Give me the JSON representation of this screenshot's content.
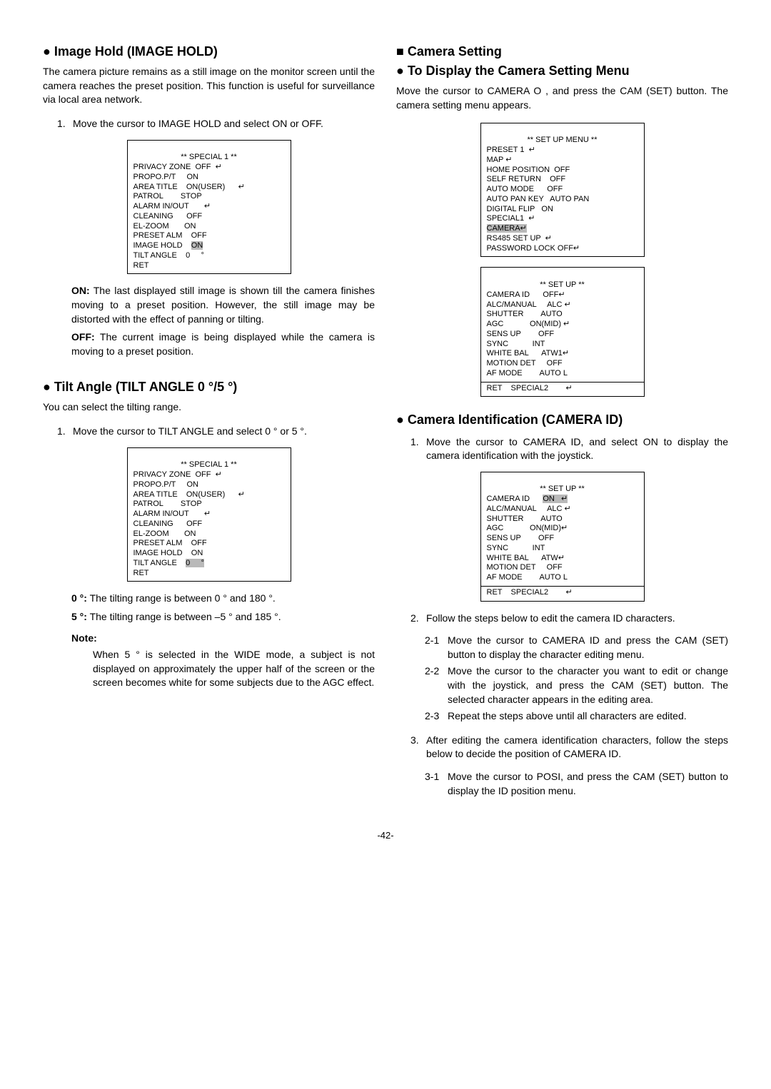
{
  "left": {
    "imageHold": {
      "heading": "Image Hold (IMAGE HOLD)",
      "intro": "The camera picture remains as a still image on the monitor screen until the camera reaches the preset position. This function is useful for surveillance via local area network.",
      "step1_num": "1.",
      "step1_txt": "Move the cursor to IMAGE HOLD and select ON or OFF.",
      "menu": {
        "title": "** SPECIAL 1 **",
        "l1": "PRIVACY ZONE  OFF  ↵",
        "l2": "PROPO.P/T     ON",
        "l3": "AREA TITLE    ON(USER)      ↵",
        "l4": "PATROL        STOP",
        "l5": "ALARM IN/OUT       ↵",
        "l6": "CLEANING      OFF",
        "l7": "EL-ZOOM       ON",
        "l8": "PRESET ALM    OFF",
        "l9a": "IMAGE HOLD    ",
        "l9b": "ON",
        "l10": "TILT ANGLE    0     °",
        "l11": "RET"
      },
      "on_label": "ON:",
      "on_txt": " The last displayed still image is shown till the camera finishes moving to a preset position. However, the still image may be distorted with the effect of panning or tilting.",
      "off_label": "OFF:",
      "off_txt": " The current image is being displayed while the camera is moving to a preset position."
    },
    "tiltAngle": {
      "heading": "Tilt Angle (TILT ANGLE 0 °/5 °)",
      "intro": "You can select the tilting range.",
      "step1_num": "1.",
      "step1_txt": "Move the cursor to TILT ANGLE and select 0 ° or 5 °.",
      "menu": {
        "title": "** SPECIAL 1 **",
        "l1": "PRIVACY ZONE  OFF  ↵",
        "l2": "PROPO.P/T     ON",
        "l3": "AREA TITLE    ON(USER)      ↵",
        "l4": "PATROL        STOP",
        "l5": "ALARM IN/OUT       ↵",
        "l6": "CLEANING      OFF",
        "l7": "EL-ZOOM       ON",
        "l8": "PRESET ALM    OFF",
        "l9": "IMAGE HOLD    ON",
        "l10a": "TILT ANGLE    ",
        "l10b": "0     °",
        "l11": "RET"
      },
      "z_label": "0 °:",
      "z_txt": " The tilting range is between 0 ° and 180 °.",
      "f_label": "5 °:",
      "f_txt": " The tilting range is between –5 ° and 185 °.",
      "note_h": "Note:",
      "note_b": "When 5 ° is selected in the WIDE mode, a subject is not displayed on approximately the upper half of the screen or the screen becomes white for some subjects due to the AGC effect."
    }
  },
  "right": {
    "cameraSetting": {
      "heading_sq": "Camera Setting",
      "heading_b": "To Display the Camera Setting Menu",
      "intro": "Move the cursor to CAMERA O , and press the CAM (SET) button. The camera setting menu appears.",
      "menu1": {
        "title": "** SET UP MENU **",
        "l1": "PRESET 1  ↵",
        "l2": "MAP ↵",
        "l3": "HOME POSITION  OFF",
        "l4": "SELF RETURN    OFF",
        "l5": "AUTO MODE      OFF",
        "l6": "AUTO PAN KEY   AUTO PAN",
        "l7": "DIGITAL FLIP   ON",
        "l8": "SPECIAL1  ↵",
        "l9": "CAMERA↵",
        "l10": "RS485 SET UP  ↵",
        "l11": "PASSWORD LOCK OFF↵"
      },
      "menu2": {
        "title": "** SET UP **",
        "l1": "CAMERA ID      OFF↵",
        "l2": "ALC/MANUAL     ALC ↵",
        "l3": "SHUTTER        AUTO",
        "l4": "AGC            ON(MID) ↵",
        "l5": "SENS UP        OFF",
        "l6": "SYNC           INT",
        "l7": "WHITE BAL      ATW1↵",
        "l8": "MOTION DET     OFF",
        "l9": "AF MODE        AUTO L",
        "f1": "RET    SPECIAL2        ↵"
      }
    },
    "cameraId": {
      "heading": "Camera Identification (CAMERA ID)",
      "step1_num": "1.",
      "step1_txt": "Move the cursor to CAMERA ID, and select ON to display the camera identification with the joystick.",
      "menu": {
        "title": "** SET UP **",
        "l1a": "CAMERA ID      ",
        "l1b": "ON   ↵",
        "l2": "ALC/MANUAL     ALC ↵",
        "l3": "SHUTTER        AUTO",
        "l4": "AGC            ON(MID)↵",
        "l5": "SENS UP        OFF",
        "l6": "SYNC           INT",
        "l7": "WHITE BAL      ATW↵",
        "l8": "MOTION DET     OFF",
        "l9": "AF MODE        AUTO L",
        "f1": "RET    SPECIAL2        ↵"
      },
      "step2_num": "2.",
      "step2_txt": "Follow the steps below to edit the camera ID characters.",
      "s21_n": "2-1",
      "s21_t": "Move the cursor to CAMERA ID and press the CAM (SET) button to display the character editing menu.",
      "s22_n": "2-2",
      "s22_t": "Move the cursor to the character you want to edit or change with the joystick, and press the CAM (SET) button. The selected character appears in the editing area.",
      "s23_n": "2-3",
      "s23_t": "Repeat the steps above until all characters are edited.",
      "step3_num": "3.",
      "step3_txt": "After editing the camera identification characters, follow the steps below to decide the position of CAMERA ID.",
      "s31_n": "3-1",
      "s31_t": "Move the cursor to POSI, and press the CAM (SET) button to display the ID position menu."
    }
  },
  "pagenum": "-42-"
}
